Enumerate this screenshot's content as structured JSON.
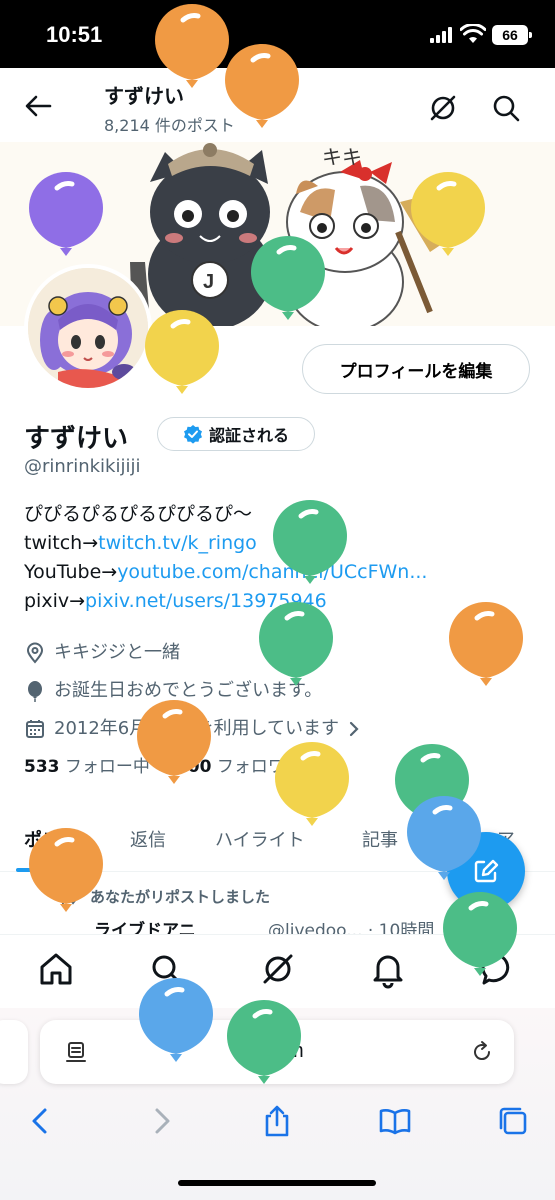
{
  "status": {
    "time": "10:51",
    "battery": "66"
  },
  "header": {
    "title": "すずけい",
    "post_count": "8,214 件のポスト"
  },
  "profile": {
    "edit_label": "プロフィールを編集",
    "name": "すずけい",
    "verify_label": "認証される",
    "handle": "@rinrinkikijiji",
    "bio": {
      "line1": "ぴぴるぴるぴるぴぴるぴ〜",
      "twitch_prefix": "twitch→",
      "twitch_link": "twitch.tv/k_ringo",
      "youtube_prefix": "YouTube→",
      "youtube_link": "youtube.com/channel/UCcFWn...",
      "pixiv_prefix": "pixiv→",
      "pixiv_link": "pixiv.net/users/13975946"
    },
    "location": "キキジジと一緒",
    "birthday": "お誕生日おめでとうございます。",
    "joined": "2012年6月からXを利用しています",
    "following_count": "533",
    "following_label": "フォロー中",
    "followers_count": "100",
    "followers_label": "フォロワー"
  },
  "tabs": [
    "ポスト",
    "返信",
    "ハイライト",
    "記事",
    "メディア"
  ],
  "feed": {
    "repost_note": "あなたがリポストしました",
    "post_name": "ライブドアニ",
    "post_meta": "@livedoo... · 10時間"
  },
  "browser": {
    "url": "x.com"
  },
  "colors": {
    "accent": "#1d9bf0",
    "text": "#0f1419",
    "muted": "#536471"
  },
  "icons": {
    "nav": [
      "home-icon",
      "search-icon",
      "grok-icon",
      "bell-icon",
      "chat-icon"
    ],
    "browser_toolbar": [
      "back-icon",
      "forward-icon",
      "share-icon",
      "bookmarks-icon",
      "tabs-icon"
    ]
  }
}
